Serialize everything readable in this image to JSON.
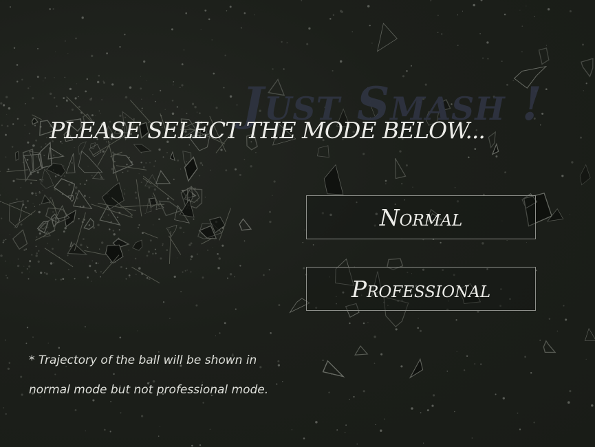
{
  "game_title": "Just Smash !",
  "heading": "PLEASE SELECT THE MODE BELOW...",
  "modes": [
    {
      "label": "Normal"
    },
    {
      "label": "Professional"
    }
  ],
  "note": {
    "line1": "* Trajectory of the ball will be shown in",
    "line2": "normal mode but not professional mode."
  },
  "colors": {
    "background": "#1b1e19",
    "text": "#ecece8",
    "watermark": "#2e3340",
    "button_border": "#8d8f8a"
  }
}
